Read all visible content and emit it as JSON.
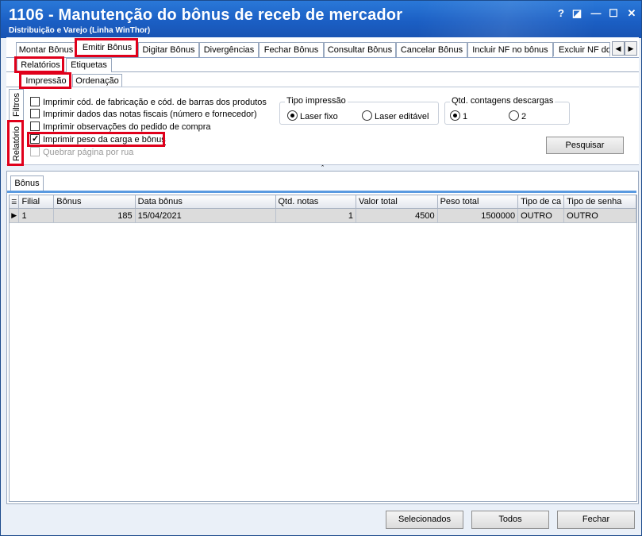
{
  "window": {
    "title": "1106 - Manutenção do bônus de receb de mercador",
    "subtitle": "Distribuição e Varejo (Linha WinThor)",
    "controls": {
      "help": "?",
      "restore": "◪",
      "minimize": "—",
      "maximize": "☐",
      "close": "✕"
    }
  },
  "main_tabs": [
    {
      "label": "Montar Bônus"
    },
    {
      "label": "Emitir Bônus",
      "active": true
    },
    {
      "label": "Digitar Bônus"
    },
    {
      "label": "Divergências"
    },
    {
      "label": "Fechar Bônus"
    },
    {
      "label": "Consultar Bônus"
    },
    {
      "label": "Cancelar Bônus"
    },
    {
      "label": "Incluir NF no bônus"
    },
    {
      "label": "Excluir NF do b"
    }
  ],
  "scroll": {
    "left": "◀",
    "right": "▶"
  },
  "sub_tabs": [
    {
      "label": "Relatórios",
      "active": true
    },
    {
      "label": "Etiquetas"
    }
  ],
  "inner_tabs": [
    {
      "label": "Impressão",
      "active": true
    },
    {
      "label": "Ordenação"
    }
  ],
  "side_tabs": [
    {
      "label": "Filtros"
    },
    {
      "label": "Relatório",
      "active": true
    }
  ],
  "options": [
    {
      "label": "Imprimir cód. de fabricação e cód. de barras dos produtos",
      "checked": false
    },
    {
      "label": "Imprimir dados das notas fiscais (número e fornecedor)",
      "checked": false
    },
    {
      "label": "Imprimir observações do pedido de compra",
      "checked": false
    },
    {
      "label": "Imprimir peso da carga e bônus",
      "checked": true
    },
    {
      "label": "Quebrar página por rua",
      "checked": false,
      "disabled": true
    }
  ],
  "tipo_impressao": {
    "legend": "Tipo impressão",
    "options": [
      {
        "label": "Laser fixo",
        "selected": true
      },
      {
        "label": "Laser editável",
        "selected": false
      }
    ]
  },
  "qtd_contagens": {
    "legend": "Qtd. contagens descargas",
    "options": [
      {
        "label": "1",
        "selected": true
      },
      {
        "label": "2",
        "selected": false
      }
    ]
  },
  "buttons": {
    "pesquisar": "Pesquisar",
    "selecionados": "Selecionados",
    "todos": "Todos",
    "fechar": "Fechar"
  },
  "splitter_glyph": "⌃",
  "grid": {
    "tab_label": "Bônus",
    "columns": [
      "Filial",
      "Bônus",
      "Data bônus",
      "Qtd. notas",
      "Valor total",
      "Peso total",
      "Tipo de ca",
      "Tipo de senha"
    ],
    "rows": [
      [
        "1",
        "185",
        "15/04/2021",
        "1",
        "4500",
        "1500000",
        "OUTRO",
        "OUTRO"
      ]
    ]
  }
}
